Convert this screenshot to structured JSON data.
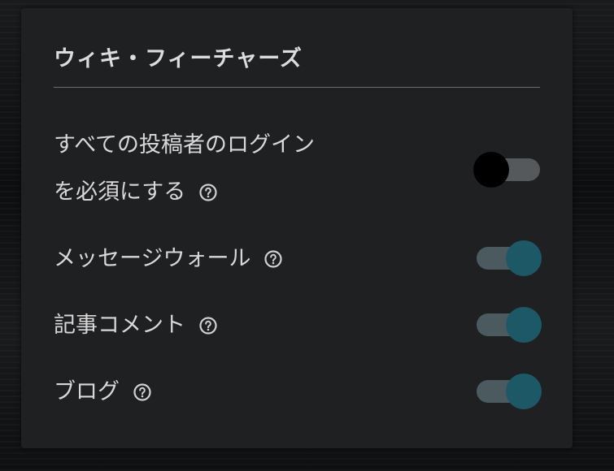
{
  "panel": {
    "title": "ウィキ・フィーチャーズ"
  },
  "settings": [
    {
      "label_line1": "すべての投稿者のログイン",
      "label_line2": "を必須にする",
      "help_icon": "question-circle-icon",
      "enabled": false
    },
    {
      "label": "メッセージウォール",
      "help_icon": "question-circle-icon",
      "enabled": true
    },
    {
      "label": "記事コメント",
      "help_icon": "question-circle-icon",
      "enabled": true
    },
    {
      "label": "ブログ",
      "help_icon": "question-circle-icon",
      "enabled": true
    }
  ],
  "colors": {
    "panel_bg": "#1f2022",
    "toggle_on": "#1d5866",
    "toggle_off_knob": "#000000",
    "text": "#d8d8d8"
  }
}
